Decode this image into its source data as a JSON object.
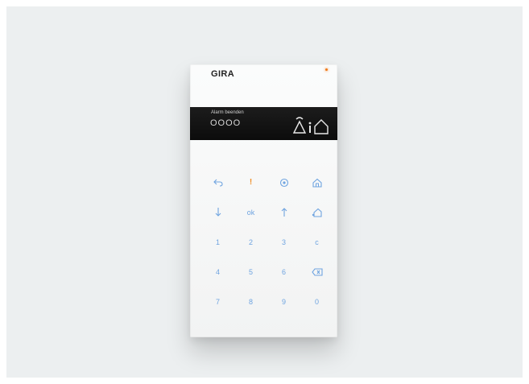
{
  "device": {
    "brand": "GIRA",
    "led_color": "#f07a1a",
    "display": {
      "text": "Alarm beenden",
      "code": "OOOO",
      "status_icons": [
        "alarm-bell-icon",
        "info-icon",
        "home-icon"
      ]
    },
    "keypad": {
      "row1": [
        {
          "icon": "back-icon",
          "label": ""
        },
        {
          "icon": "alert-icon",
          "label": "!"
        },
        {
          "icon": "settings-icon",
          "label": ""
        },
        {
          "icon": "home-icon",
          "label": ""
        }
      ],
      "row2": [
        {
          "icon": "arrow-down-icon",
          "label": ""
        },
        {
          "icon": "",
          "label": "ok"
        },
        {
          "icon": "arrow-up-icon",
          "label": ""
        },
        {
          "icon": "partial-arm-icon",
          "label": ""
        }
      ],
      "row3": [
        "1",
        "2",
        "3",
        "c"
      ],
      "row4": [
        "4",
        "5",
        "6",
        "delete-icon"
      ],
      "row5": [
        "7",
        "8",
        "9",
        "0"
      ]
    },
    "colors": {
      "key_blue": "#6fa4e0",
      "alert_orange": "#f0902a"
    }
  }
}
